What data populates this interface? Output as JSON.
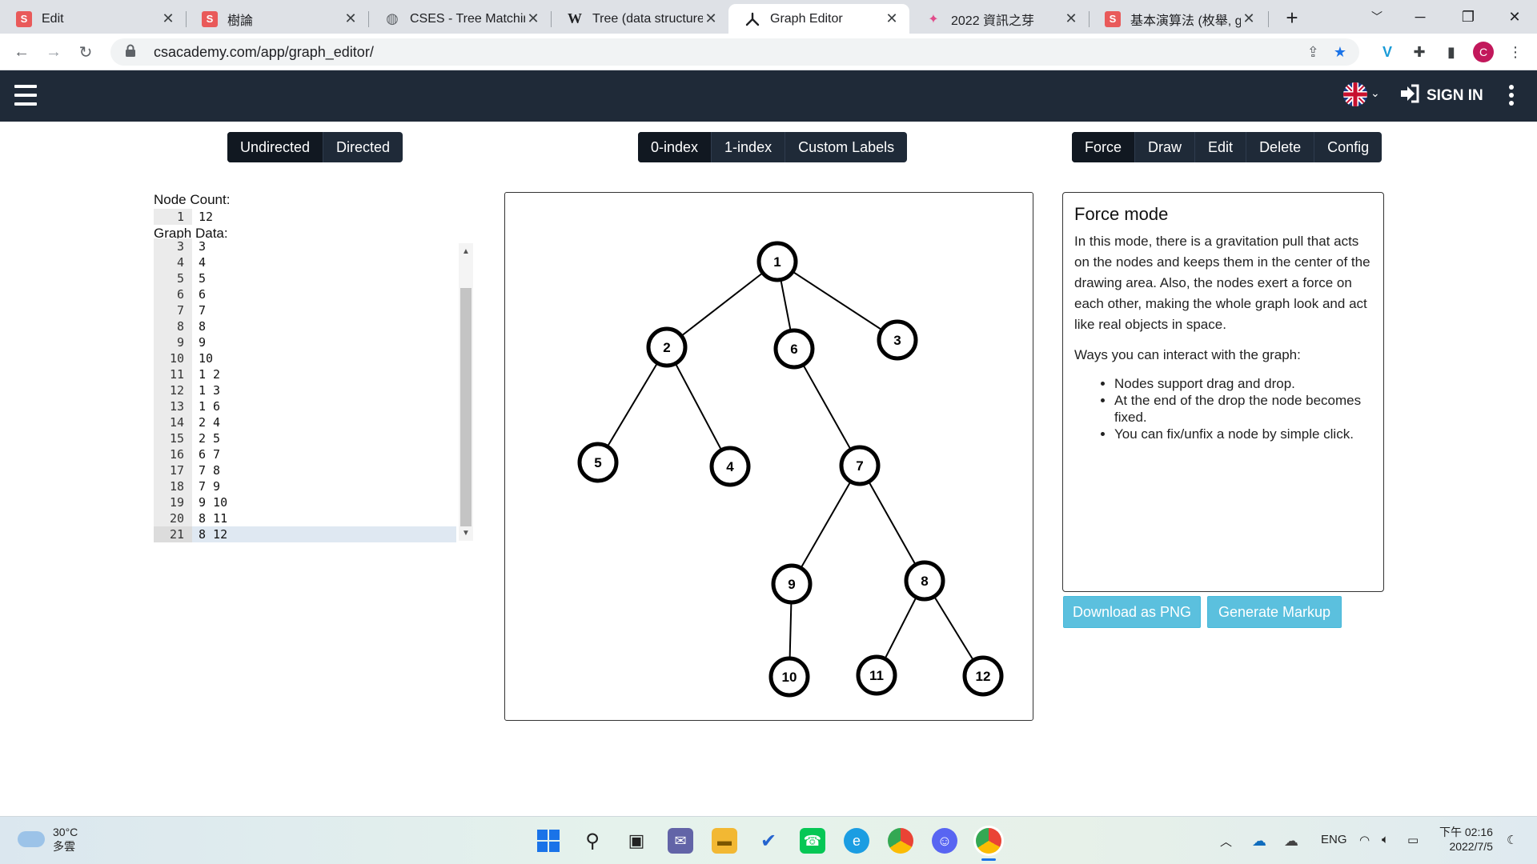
{
  "browser": {
    "tabs": [
      {
        "title": "Edit",
        "icon": "s-icon",
        "color": "#e95a5a"
      },
      {
        "title": "樹論",
        "icon": "s-icon",
        "color": "#e95a5a"
      },
      {
        "title": "CSES - Tree Matching",
        "icon": "globe-icon",
        "color": "#5f6368"
      },
      {
        "title": "Tree (data structure)",
        "icon": "w-icon",
        "color": "#202124"
      },
      {
        "title": "Graph Editor",
        "icon": "graph-icon",
        "color": "#202124"
      },
      {
        "title": "2022 資訊之芽",
        "icon": "sprout-icon",
        "color": "#e14b8a"
      },
      {
        "title": "基本演算法 (枚舉, gre",
        "icon": "s-icon",
        "color": "#e95a5a"
      }
    ],
    "new_tab": "+",
    "url": "csacademy.com/app/graph_editor/",
    "profile_initial": "C"
  },
  "site": {
    "sign_in": "SIGN IN"
  },
  "toolbar": {
    "direction": [
      "Undirected",
      "Directed"
    ],
    "indexing": [
      "0-index",
      "1-index",
      "Custom Labels"
    ],
    "modes": [
      "Force",
      "Draw",
      "Edit",
      "Delete",
      "Config"
    ]
  },
  "editor": {
    "node_count_label": "Node Count:",
    "node_count_line": "1",
    "node_count_value": "12",
    "graph_data_label": "Graph Data:",
    "lines": [
      {
        "n": "3",
        "t": "3"
      },
      {
        "n": "4",
        "t": "4"
      },
      {
        "n": "5",
        "t": "5"
      },
      {
        "n": "6",
        "t": "6"
      },
      {
        "n": "7",
        "t": "7"
      },
      {
        "n": "8",
        "t": "8"
      },
      {
        "n": "9",
        "t": "9"
      },
      {
        "n": "10",
        "t": "10"
      },
      {
        "n": "11",
        "t": "1 2"
      },
      {
        "n": "12",
        "t": "1 3"
      },
      {
        "n": "13",
        "t": "1 6"
      },
      {
        "n": "14",
        "t": "2 4"
      },
      {
        "n": "15",
        "t": "2 5"
      },
      {
        "n": "16",
        "t": "6 7"
      },
      {
        "n": "17",
        "t": "7 8"
      },
      {
        "n": "18",
        "t": "7 9"
      },
      {
        "n": "19",
        "t": "9 10"
      },
      {
        "n": "20",
        "t": "8 11"
      },
      {
        "n": "21",
        "t": "8 12"
      }
    ]
  },
  "graph": {
    "nodes": [
      "1",
      "2",
      "3",
      "4",
      "5",
      "6",
      "7",
      "8",
      "9",
      "10",
      "11",
      "12"
    ],
    "edges": [
      [
        "1",
        "2"
      ],
      [
        "1",
        "3"
      ],
      [
        "1",
        "6"
      ],
      [
        "2",
        "4"
      ],
      [
        "2",
        "5"
      ],
      [
        "6",
        "7"
      ],
      [
        "7",
        "8"
      ],
      [
        "7",
        "9"
      ],
      [
        "9",
        "10"
      ],
      [
        "8",
        "11"
      ],
      [
        "8",
        "12"
      ]
    ]
  },
  "info": {
    "title": "Force mode",
    "description": "In this mode, there is a gravitation pull that acts on the nodes and keeps them in the center of the drawing area. Also, the nodes exert a force on each other, making the whole graph look and act like real objects in space.",
    "ways_label": "Ways you can interact with the graph:",
    "bullets": [
      "Nodes support drag and drop.",
      "At the end of the drop the node becomes fixed.",
      "You can fix/unfix a node by simple click."
    ]
  },
  "actions": {
    "download": "Download as PNG",
    "markup": "Generate Markup"
  },
  "taskbar": {
    "temp": "30°C",
    "weather": "多雲",
    "lang": "ENG",
    "time": "下午 02:16",
    "date": "2022/7/5"
  }
}
